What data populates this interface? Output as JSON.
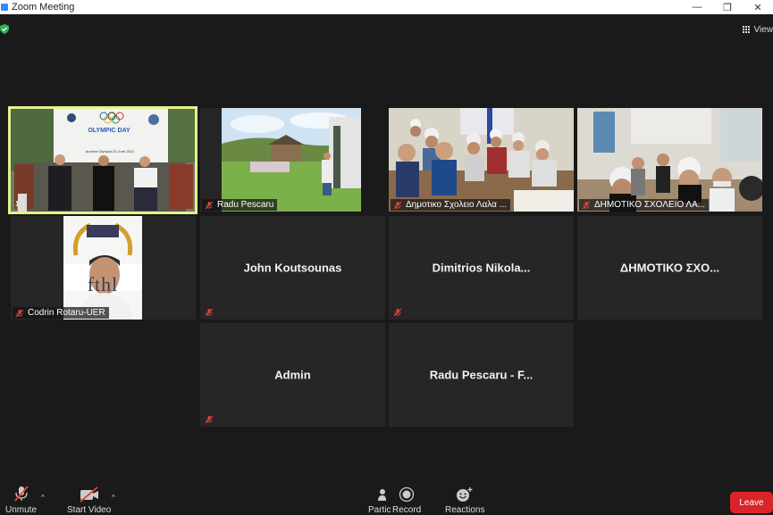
{
  "window": {
    "title": "Zoom Meeting",
    "controls": [
      "—",
      "❐",
      "✕"
    ]
  },
  "top": {
    "view_label": "View"
  },
  "gallery": {
    "tiles": [
      {
        "name": "",
        "type": "video",
        "scene": "olympic-day"
      },
      {
        "name": "Radu Pescaru",
        "type": "video",
        "scene": "field"
      },
      {
        "name": "Δημοτικο Σχολειο Λαλα ...",
        "type": "video",
        "scene": "classroom-1"
      },
      {
        "name": "ΔΗΜΟΤΙΚΟ ΣΧΟΛΕΙΟ ΛΑ...",
        "type": "video",
        "scene": "classroom-2"
      },
      {
        "name": "Codrin Rotaru-UER",
        "type": "video",
        "scene": "portrait"
      },
      {
        "name": "John Koutsounas",
        "type": "name"
      },
      {
        "name": "Dimitrios  Nikola...",
        "type": "name"
      },
      {
        "name": "ΔΗΜΟΤΙΚΟ  ΣΧΟ...",
        "type": "name"
      },
      {
        "name": "Admin",
        "type": "name"
      },
      {
        "name": "Radu Pescaru - F...",
        "type": "name"
      }
    ],
    "olympic_banner": {
      "line1": "OLYMPIC DAY",
      "line2": "Ancient Olympia 23 June 2021"
    },
    "portrait_text": "fthl"
  },
  "toolbar": {
    "unmute": "Unmute",
    "start_video": "Start Video",
    "participants": "Partic",
    "record": "Record",
    "reactions": "Reactions",
    "leave": "Leave"
  },
  "colors": {
    "active_border": "#e3f28b",
    "leave": "#d9252a",
    "muted": "#e0463a"
  }
}
